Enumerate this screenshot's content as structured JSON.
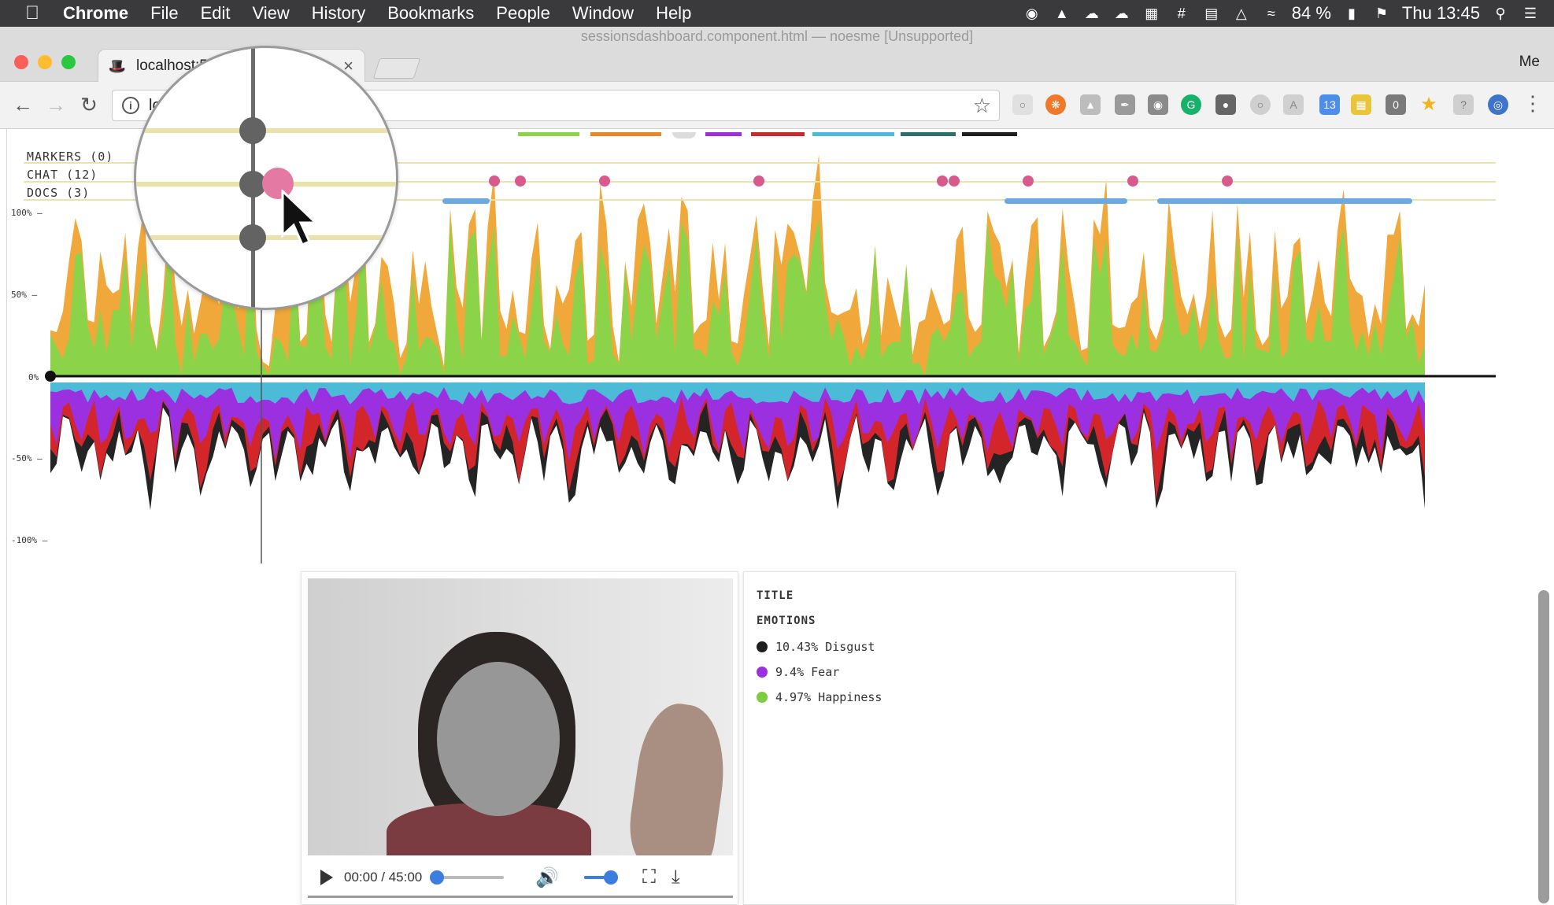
{
  "menubar": {
    "apple_icon": "apple-icon",
    "items": [
      "Chrome",
      "File",
      "Edit",
      "View",
      "History",
      "Bookmarks",
      "People",
      "Window",
      "Help"
    ],
    "battery": "84 %",
    "clock": "Thu 13:45"
  },
  "window": {
    "title": "sessionsdashboard.component.html — noesme [Unsupported]",
    "tab_title": "localhost:5",
    "profile": "Me",
    "address": "lo"
  },
  "tracks": {
    "markers_label": "MARKERS (0)",
    "chat_label": "CHAT (12)",
    "docs_label": "DOCS (3)"
  },
  "axis": {
    "labels": [
      "100% —",
      "50% —",
      "0%",
      "-50% —",
      "-100% —"
    ]
  },
  "legend_colors": [
    "#8bd44a",
    "#e8862e",
    "#dcdcdc",
    "#9b30d9",
    "#c92a2a",
    "#4bbbd8",
    "#2f6f6b",
    "#1e1e1e"
  ],
  "colors": {
    "happiness": "#8bd44a",
    "surprise": "#f0a83a",
    "sadness": "#4bbbd8",
    "fear": "#9b30e0",
    "anger": "#d3262a",
    "disgust": "#242424",
    "chat": "#d85a8c",
    "docs": "#6aa9e2"
  },
  "player": {
    "time": "00:00 / 45:00",
    "progress": 0.0,
    "volume": 0.85
  },
  "info": {
    "title": "TITLE",
    "subtitle": "EMOTIONS",
    "emotions": [
      {
        "text": "10.43% Disgust",
        "color": "#1e1e1e"
      },
      {
        "text": "9.4% Fear",
        "color": "#9b30e0"
      },
      {
        "text": "4.97% Happiness",
        "color": "#7ccc3f"
      }
    ]
  }
}
